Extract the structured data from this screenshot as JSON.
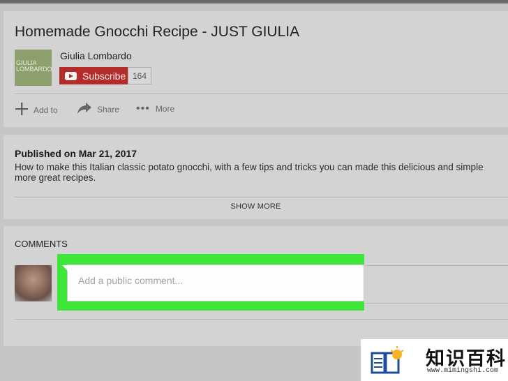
{
  "video": {
    "title": "Homemade Gnocchi Recipe - JUST GIULIA",
    "channel_avatar_text": [
      "GIULIA",
      "LOMBARDO"
    ],
    "channel_name": "Giulia Lombardo",
    "subscribe_label": "Subscribe",
    "subscriber_count": "164",
    "actions": {
      "add_to": "Add to",
      "share": "Share",
      "more": "More"
    }
  },
  "description": {
    "published": "Published on Mar 21, 2017",
    "line1": "How to make this Italian classic potato gnocchi, with a few tips and tricks you can made this delicious and simple",
    "line2": "more great recipes.",
    "show_more": "SHOW MORE"
  },
  "comments": {
    "heading": "COMMENTS",
    "placeholder": "Add a public comment...",
    "highlight_color": "#3ee63a"
  },
  "watermark": {
    "cn_text": "知识百科",
    "url": "www.mimingshi.com"
  }
}
